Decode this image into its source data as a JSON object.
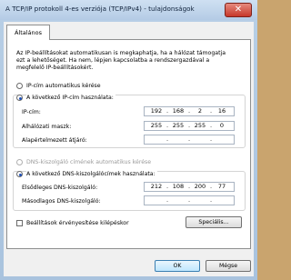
{
  "window": {
    "title": "A TCP/IP protokoll 4-es verziója (TCP/IPv4) - tulajdonságok",
    "close_glyph": "✕"
  },
  "tabs": [
    {
      "label": "Általános"
    }
  ],
  "description": "Az IP-beállításokat automatikusan is megkaphatja, ha a hálózat támogatja ezt a lehetőséget. Ha nem, lépjen kapcsolatba a rendszergazdával a megfelelő IP-beállításokért.",
  "ip_mode": {
    "auto_label": "IP-cím automatikus kérése",
    "manual_label": "A következő IP-cím használata:",
    "selected": "manual"
  },
  "ip_fields": {
    "ip_label": "IP-cím:",
    "ip_value": [
      "192",
      "168",
      "2",
      "16"
    ],
    "mask_label": "Alhálózati maszk:",
    "mask_value": [
      "255",
      "255",
      "255",
      "0"
    ],
    "gateway_label": "Alapértelmezett átjáró:",
    "gateway_value": [
      "",
      "",
      "",
      ""
    ]
  },
  "dns_mode": {
    "auto_label": "DNS-kiszolgáló címének automatikus kérése",
    "manual_label": "A következő DNS-kiszolgálócímek használata:",
    "selected": "manual"
  },
  "dns_fields": {
    "preferred_label": "Elsődleges DNS-kiszolgáló:",
    "preferred_value": [
      "212",
      "108",
      "200",
      "77"
    ],
    "alternate_label": "Másodlagos DNS-kiszolgáló:",
    "alternate_value": [
      "",
      "",
      "",
      ""
    ]
  },
  "validate_label": "Beállítások érvényesítése kilépéskor",
  "buttons": {
    "advanced": "Speciális...",
    "ok": "OK",
    "cancel": "Mégse"
  }
}
